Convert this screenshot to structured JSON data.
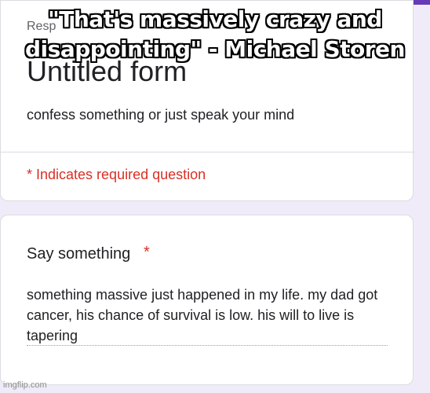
{
  "meme": {
    "caption": "\"That's massively crazy and disappointing\" - Michael Storen"
  },
  "form": {
    "responder_label": "Resp",
    "title": "Untitled form",
    "description": "confess something or just speak your mind",
    "required_note": "* Indicates required question"
  },
  "question": {
    "title": "Say something",
    "required_marker": "*",
    "answer": "something massive just happened in my life. my dad got cancer, his chance of survival is low. his will to live is tapering"
  },
  "watermark": "imgflip.com",
  "colors": {
    "accent": "#673ab7",
    "background": "#f0ebf8",
    "required": "#d93025"
  }
}
